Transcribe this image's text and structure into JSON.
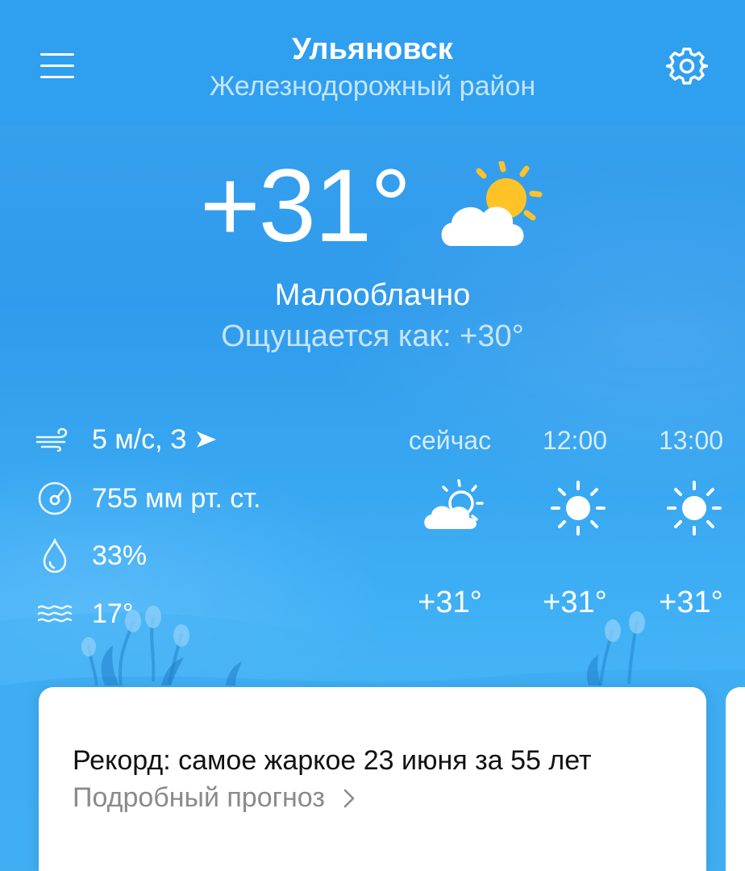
{
  "header": {
    "city": "Ульяновск",
    "district": "Железнодорожный район"
  },
  "current": {
    "temperature": "+31°",
    "condition": "Малооблачно",
    "feels_like": "Ощущается как: +30°",
    "icon": "partly-cloudy-sun-icon"
  },
  "params": [
    {
      "icon": "wind-icon",
      "value": "5 м/с, З"
    },
    {
      "icon": "pressure-icon",
      "value": "755 мм рт. ст."
    },
    {
      "icon": "humidity-drop-icon",
      "value": "33%"
    },
    {
      "icon": "water-temperature-icon",
      "value": "17°"
    }
  ],
  "hourly": [
    {
      "time": "сейчас",
      "icon": "partly-cloudy-sun-icon",
      "temp": "+31°"
    },
    {
      "time": "12:00",
      "icon": "sun-icon",
      "temp": "+31°"
    },
    {
      "time": "13:00",
      "icon": "sun-icon",
      "temp": "+31°"
    }
  ],
  "card": {
    "title": "Рекорд: самое жаркое 23 июня за 55 лет",
    "link": "Подробный прогноз"
  },
  "colors": {
    "sky": "#2f9ff0",
    "sun": "#ffc328",
    "card": "#ffffff",
    "link_gray": "#8a8a8a"
  }
}
